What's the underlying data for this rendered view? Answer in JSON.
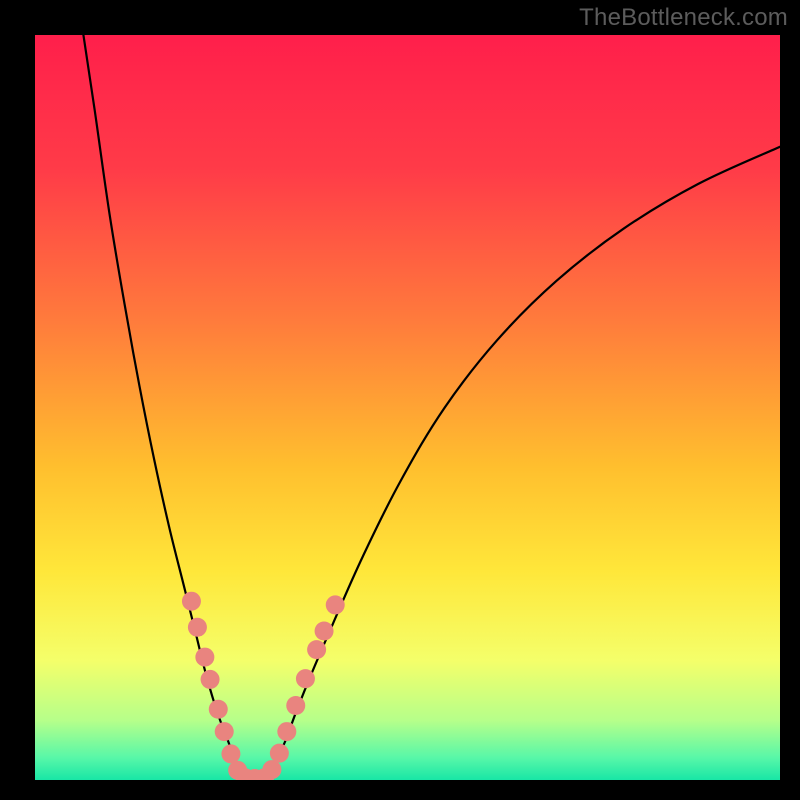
{
  "watermark": "TheBottleneck.com",
  "chart_data": {
    "type": "line",
    "title": "",
    "xlabel": "",
    "ylabel": "",
    "xlim": [
      0,
      100
    ],
    "ylim": [
      0,
      100
    ],
    "gradient_stops": [
      {
        "offset": 0,
        "color": "#ff1f4b"
      },
      {
        "offset": 18,
        "color": "#ff3b48"
      },
      {
        "offset": 38,
        "color": "#ff7a3c"
      },
      {
        "offset": 58,
        "color": "#ffbf2e"
      },
      {
        "offset": 72,
        "color": "#ffe73a"
      },
      {
        "offset": 84,
        "color": "#f4ff6a"
      },
      {
        "offset": 92,
        "color": "#b6ff8a"
      },
      {
        "offset": 97,
        "color": "#58f7a8"
      },
      {
        "offset": 100,
        "color": "#18e6a6"
      }
    ],
    "series": [
      {
        "name": "left-branch",
        "x": [
          6.5,
          8,
          10,
          12,
          14,
          16,
          18,
          20,
          21.5,
          23,
          24.5,
          26,
          27,
          28
        ],
        "y": [
          100,
          90,
          76,
          64,
          53,
          43,
          34,
          26,
          20,
          14,
          9,
          5,
          2,
          0
        ]
      },
      {
        "name": "right-branch",
        "x": [
          31,
          32,
          33.5,
          35,
          37,
          40,
          44,
          49,
          55,
          62,
          70,
          79,
          89,
          100
        ],
        "y": [
          0,
          2,
          5,
          9,
          14,
          21,
          30,
          40,
          50,
          59,
          67,
          74,
          80,
          85
        ]
      },
      {
        "name": "valley-floor",
        "x": [
          28,
          29.5,
          31
        ],
        "y": [
          0,
          0,
          0
        ]
      }
    ],
    "markers": {
      "name": "highlight-dots",
      "points": [
        {
          "x": 21.0,
          "y": 24.0
        },
        {
          "x": 21.8,
          "y": 20.5
        },
        {
          "x": 22.8,
          "y": 16.5
        },
        {
          "x": 23.5,
          "y": 13.5
        },
        {
          "x": 24.6,
          "y": 9.5
        },
        {
          "x": 25.4,
          "y": 6.5
        },
        {
          "x": 26.3,
          "y": 3.5
        },
        {
          "x": 27.2,
          "y": 1.3
        },
        {
          "x": 28.2,
          "y": 0.3
        },
        {
          "x": 29.5,
          "y": 0.2
        },
        {
          "x": 30.8,
          "y": 0.3
        },
        {
          "x": 31.8,
          "y": 1.4
        },
        {
          "x": 32.8,
          "y": 3.6
        },
        {
          "x": 33.8,
          "y": 6.5
        },
        {
          "x": 35.0,
          "y": 10.0
        },
        {
          "x": 36.3,
          "y": 13.6
        },
        {
          "x": 37.8,
          "y": 17.5
        },
        {
          "x": 38.8,
          "y": 20.0
        },
        {
          "x": 40.3,
          "y": 23.5
        }
      ]
    }
  }
}
